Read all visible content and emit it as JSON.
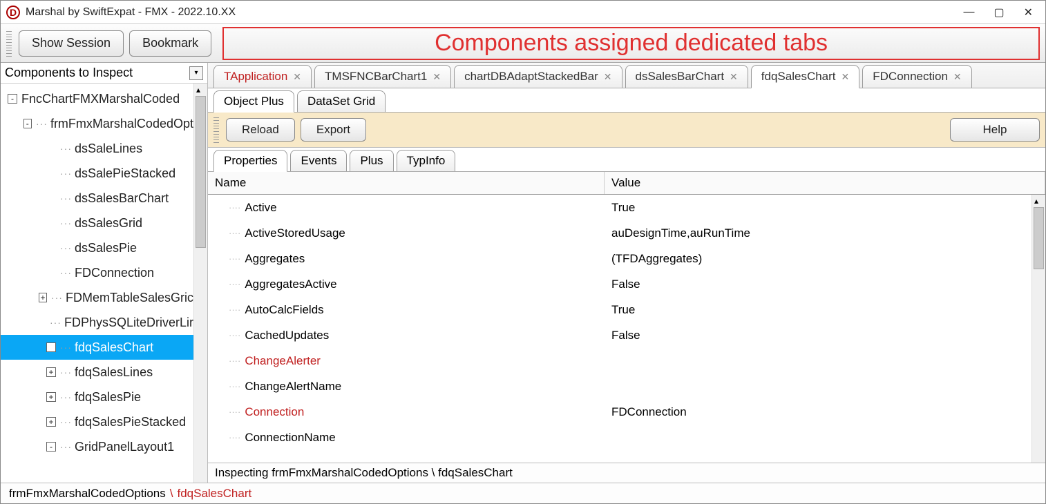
{
  "window": {
    "title": "Marshal by SwiftExpat - FMX - 2022.10.XX",
    "icon_letter": "D"
  },
  "toolbar": {
    "show_session": "Show Session",
    "bookmark": "Bookmark"
  },
  "annotation": "Components assigned dedicated tabs",
  "left": {
    "header": "Components to Inspect",
    "tree": [
      {
        "indent": 0,
        "expander": "-",
        "label": "FncChartFMXMarshalCoded"
      },
      {
        "indent": 1,
        "expander": "-",
        "label": "frmFmxMarshalCodedOpt"
      },
      {
        "indent": 2,
        "expander": "",
        "label": "dsSaleLines"
      },
      {
        "indent": 2,
        "expander": "",
        "label": "dsSalePieStacked"
      },
      {
        "indent": 2,
        "expander": "",
        "label": "dsSalesBarChart"
      },
      {
        "indent": 2,
        "expander": "",
        "label": "dsSalesGrid"
      },
      {
        "indent": 2,
        "expander": "",
        "label": "dsSalesPie"
      },
      {
        "indent": 2,
        "expander": "",
        "label": "FDConnection"
      },
      {
        "indent": 2,
        "expander": "+",
        "label": "FDMemTableSalesGric"
      },
      {
        "indent": 2,
        "expander": "",
        "label": "FDPhysSQLiteDriverLir"
      },
      {
        "indent": 2,
        "expander": "+",
        "label": "fdqSalesChart",
        "selected": true
      },
      {
        "indent": 2,
        "expander": "+",
        "label": "fdqSalesLines"
      },
      {
        "indent": 2,
        "expander": "+",
        "label": "fdqSalesPie"
      },
      {
        "indent": 2,
        "expander": "+",
        "label": "fdqSalesPieStacked"
      },
      {
        "indent": 2,
        "expander": "-",
        "label": "GridPanelLayout1"
      }
    ]
  },
  "component_tabs": [
    {
      "label": "TApplication",
      "closable": true,
      "red": true
    },
    {
      "label": "TMSFNCBarChart1",
      "closable": true
    },
    {
      "label": "chartDBAdaptStackedBar",
      "closable": true
    },
    {
      "label": "dsSalesBarChart",
      "closable": true
    },
    {
      "label": "fdqSalesChart",
      "closable": true,
      "active": true
    },
    {
      "label": "FDConnection",
      "closable": true
    }
  ],
  "view_tabs": [
    {
      "label": "Object Plus",
      "active": true
    },
    {
      "label": "DataSet Grid"
    }
  ],
  "actions": {
    "reload": "Reload",
    "export": "Export",
    "help": "Help"
  },
  "prop_tabs": [
    {
      "label": "Properties",
      "active": true
    },
    {
      "label": "Events"
    },
    {
      "label": "Plus"
    },
    {
      "label": "TypInfo"
    }
  ],
  "grid": {
    "col_name": "Name",
    "col_value": "Value",
    "rows": [
      {
        "name": "Active",
        "value": "True"
      },
      {
        "name": "ActiveStoredUsage",
        "value": "auDesignTime,auRunTime"
      },
      {
        "name": "Aggregates",
        "value": "(TFDAggregates)"
      },
      {
        "name": "AggregatesActive",
        "value": "False"
      },
      {
        "name": "AutoCalcFields",
        "value": "True"
      },
      {
        "name": "CachedUpdates",
        "value": "False"
      },
      {
        "name": "ChangeAlerter",
        "value": "",
        "red": true
      },
      {
        "name": "ChangeAlertName",
        "value": ""
      },
      {
        "name": "Connection",
        "value": "FDConnection",
        "red": true
      },
      {
        "name": "ConnectionName",
        "value": ""
      }
    ]
  },
  "inspecting_line": "Inspecting frmFmxMarshalCodedOptions \\ fdqSalesChart",
  "footer": {
    "part1": "frmFmxMarshalCodedOptions",
    "sep": "\\",
    "part2": "fdqSalesChart"
  }
}
